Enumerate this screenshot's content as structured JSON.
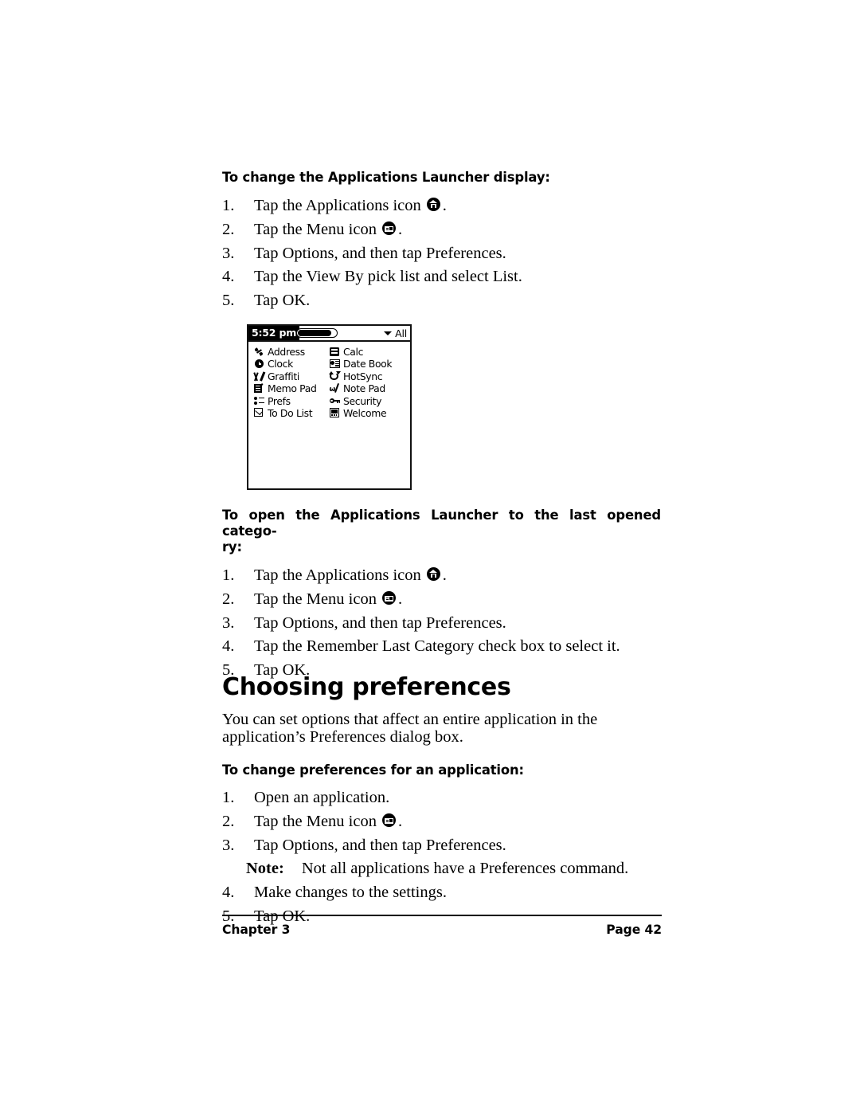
{
  "document": {
    "chapter_label": "Chapter 3",
    "page_label": "Page 42"
  },
  "section_1": {
    "heading": "To change the Applications Launcher display:",
    "steps": [
      {
        "num": "1.",
        "text_before": "Tap the Applications icon",
        "icon": "applications-home-icon",
        "text_after": "."
      },
      {
        "num": "2.",
        "text_before": "Tap the Menu icon",
        "icon": "menu-icon",
        "text_after": "."
      },
      {
        "num": "3.",
        "text_before": "Tap Options, and then tap Preferences.",
        "icon": null,
        "text_after": ""
      },
      {
        "num": "4.",
        "text_before": "Tap the View By pick list and select List.",
        "icon": null,
        "text_after": ""
      },
      {
        "num": "5.",
        "text_before": "Tap OK.",
        "icon": null,
        "text_after": ""
      }
    ]
  },
  "pda_screenshot": {
    "title_bar": {
      "time": "5:52 pm",
      "battery_icon": "battery-full-icon",
      "category_label": "All",
      "category_chevron": "chevron-down-icon"
    },
    "apps_left": [
      {
        "label": "Address",
        "icon": "phone-handset-icon"
      },
      {
        "label": "Clock",
        "icon": "clock-icon"
      },
      {
        "label": "Graffiti",
        "icon": "graffiti-strokes-icon"
      },
      {
        "label": "Memo Pad",
        "icon": "memo-pad-icon"
      },
      {
        "label": "Prefs",
        "icon": "preferences-sliders-icon"
      },
      {
        "label": "To Do List",
        "icon": "checkbox-checked-icon"
      }
    ],
    "apps_right": [
      {
        "label": "Calc",
        "icon": "calculator-icon"
      },
      {
        "label": "Date Book",
        "icon": "date-book-icon"
      },
      {
        "label": "HotSync",
        "icon": "hotsync-arrows-icon"
      },
      {
        "label": "Note Pad",
        "icon": "note-pad-pen-icon"
      },
      {
        "label": "Security",
        "icon": "key-icon"
      },
      {
        "label": "Welcome",
        "icon": "welcome-screen-icon"
      }
    ]
  },
  "section_2": {
    "heading_line_1": "To open the Applications Launcher to the last opened catego-",
    "heading_line_2": "ry:",
    "steps": [
      {
        "num": "1.",
        "text_before": "Tap the Applications icon",
        "icon": "applications-home-icon",
        "text_after": "."
      },
      {
        "num": "2.",
        "text_before": "Tap the Menu icon",
        "icon": "menu-icon",
        "text_after": "."
      },
      {
        "num": "3.",
        "text_before": "Tap Options, and then tap Preferences.",
        "icon": null,
        "text_after": ""
      },
      {
        "num": "4.",
        "text_before": "Tap the Remember Last Category check box to select it.",
        "icon": null,
        "text_after": ""
      },
      {
        "num": "5.",
        "text_before": "Tap OK.",
        "icon": null,
        "text_after": ""
      }
    ]
  },
  "section_3": {
    "title": "Choosing preferences",
    "paragraph_line_1": "You can set options that affect an entire application in the",
    "paragraph_line_2": "application’s Preferences dialog box.",
    "heading": "To change preferences for an application:",
    "steps_a": [
      {
        "num": "1.",
        "text_before": "Open an application.",
        "icon": null,
        "text_after": ""
      },
      {
        "num": "2.",
        "text_before": "Tap the Menu icon",
        "icon": "menu-icon",
        "text_after": "."
      },
      {
        "num": "3.",
        "text_before": "Tap Options, and then tap Preferences.",
        "icon": null,
        "text_after": ""
      }
    ],
    "note": {
      "label": "Note:",
      "text": "Not all applications have a Preferences command."
    },
    "steps_b": [
      {
        "num": "4.",
        "text_before": "Make changes to the settings.",
        "icon": null,
        "text_after": ""
      },
      {
        "num": "5.",
        "text_before": "Tap OK.",
        "icon": null,
        "text_after": ""
      }
    ]
  },
  "colors": {
    "ink": "#000000",
    "paper": "#ffffff"
  }
}
